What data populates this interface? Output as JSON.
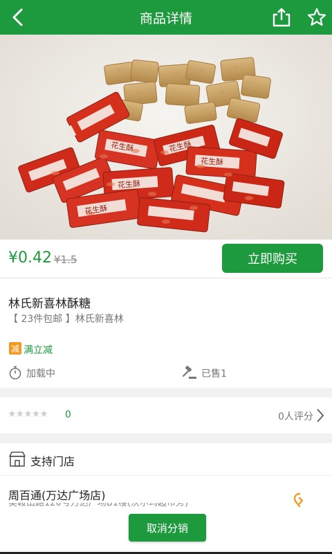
{
  "header": {
    "title": "商品详情",
    "icons": [
      "back-arrow-icon",
      "share-icon",
      "star-icon"
    ],
    "bg_color": "#1e9a3e"
  },
  "product": {
    "name": "林氏新喜林酥糖",
    "subtitle": "【 23件包邮 】林氏新喜林",
    "price": "¥0.42",
    "original_price": "¥1.5",
    "buy_label": "立即购买",
    "wrapper_text": "花生酥"
  },
  "promo": {
    "badge": "减",
    "text": "满立减"
  },
  "status": {
    "countdown": "加载中",
    "sold": "已售1"
  },
  "rating": {
    "score": "0",
    "review_count": "0人评分"
  },
  "stores": {
    "title": "支持门店",
    "items": [
      {
        "name": "周百通(万达广场店)",
        "address": "吴鞍山路120号万达广场B1楼(沃尔玛超市旁)"
      }
    ]
  },
  "actions": {
    "cancel_distribution": "取消分销"
  }
}
